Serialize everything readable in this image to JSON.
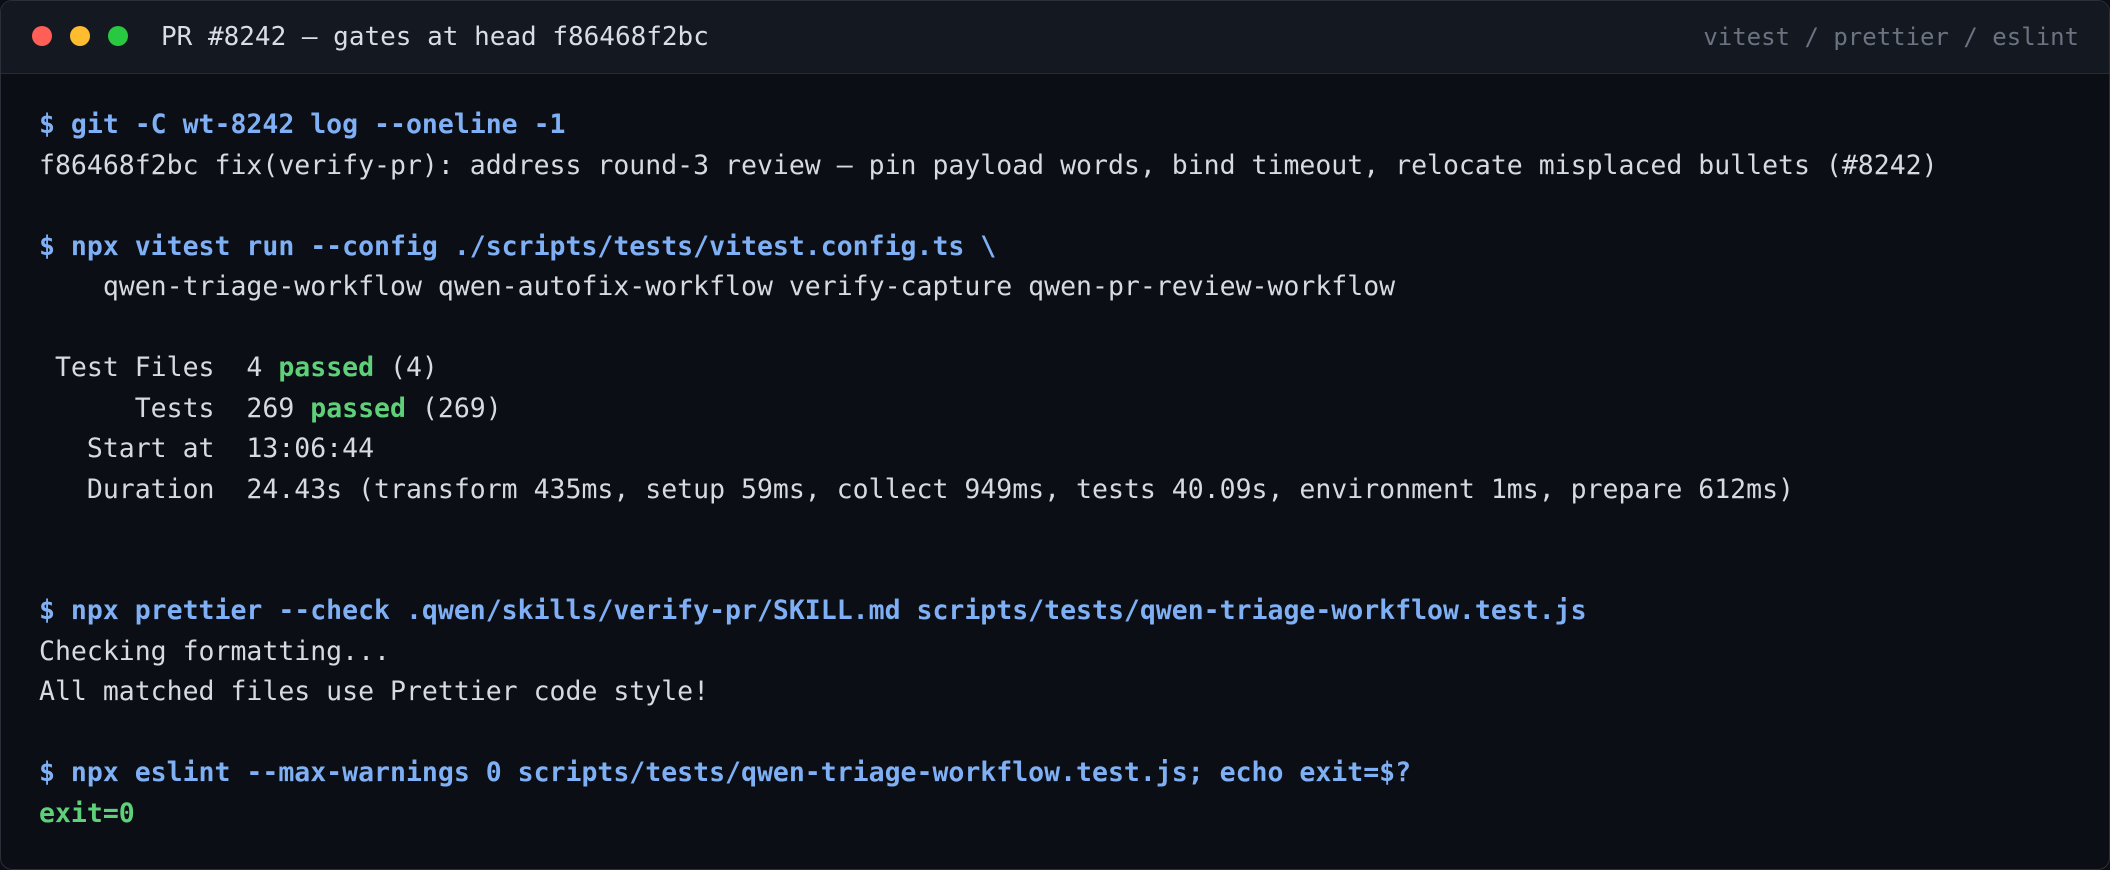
{
  "window": {
    "title": "PR #8242 — gates at head f86468f2bc",
    "tools": "vitest / prettier / eslint"
  },
  "terminal": {
    "git": {
      "command": "$ git -C wt-8242 log --oneline -1",
      "output": "f86468f2bc fix(verify-pr): address round-3 review — pin payload words, bind timeout, relocate misplaced bullets (#8242)"
    },
    "vitest": {
      "command": "$ npx vitest run --config ./scripts/tests/vitest.config.ts \\",
      "command_cont": "    qwen-triage-workflow qwen-autofix-workflow verify-capture qwen-pr-review-workflow",
      "test_files_label": " Test Files  4 ",
      "test_files_status": "passed",
      "test_files_count": " (4)",
      "tests_label": "      Tests  269 ",
      "tests_status": "passed",
      "tests_count": " (269)",
      "start_at": "   Start at  13:06:44",
      "duration": "   Duration  24.43s (transform 435ms, setup 59ms, collect 949ms, tests 40.09s, environment 1ms, prepare 612ms)"
    },
    "prettier": {
      "command": "$ npx prettier --check .qwen/skills/verify-pr/SKILL.md scripts/tests/qwen-triage-workflow.test.js",
      "output_1": "Checking formatting...",
      "output_2": "All matched files use Prettier code style!"
    },
    "eslint": {
      "command": "$ npx eslint --max-warnings 0 scripts/tests/qwen-triage-workflow.test.js; echo exit=$?",
      "result": "exit=0"
    }
  },
  "colors": {
    "background": "#0b0e14",
    "titlebar": "#141821",
    "command": "#7fb0f5",
    "passed": "#5fd07a",
    "text": "#d6dae2"
  }
}
